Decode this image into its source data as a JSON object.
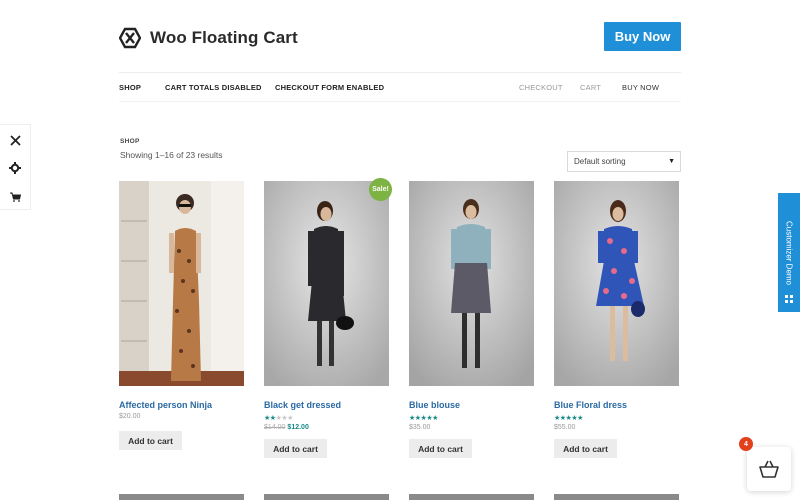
{
  "header": {
    "site_title": "Woo Floating Cart",
    "buy_now_label": "Buy Now"
  },
  "nav": {
    "left": [
      "SHOP",
      "CART TOTALS DISABLED",
      "CHECKOUT FORM ENABLED"
    ],
    "right": [
      "CHECKOUT",
      "CART",
      "BUY NOW"
    ]
  },
  "shop": {
    "breadcrumb": "SHOP",
    "result_count": "Showing 1–16 of 23 results",
    "sort_selected": "Default sorting"
  },
  "products": [
    {
      "title": "Affected person Ninja",
      "rating": null,
      "price": "$20.00",
      "old_price": null,
      "add_label": "Add to cart",
      "sale": false
    },
    {
      "title": "Black get dressed",
      "rating": 2,
      "price": "$12.00",
      "old_price": "$14.00",
      "add_label": "Add to cart",
      "sale": true,
      "sale_label": "Sale!"
    },
    {
      "title": "Blue blouse",
      "rating": 5,
      "price": "$35.00",
      "old_price": null,
      "add_label": "Add to cart",
      "sale": false
    },
    {
      "title": "Blue Floral dress",
      "rating": 5,
      "price": "$55.00",
      "old_price": null,
      "add_label": "Add to cart",
      "sale": false
    }
  ],
  "customizer": {
    "label": "Customizer Demo"
  },
  "floating_cart": {
    "count": "4"
  },
  "icons": {
    "side_tools": [
      "close-icon",
      "gear-icon",
      "cart-icon"
    ],
    "floating_cart": "shopping-basket-icon"
  },
  "colors": {
    "accent": "#1f8fd8",
    "link": "#2a6aa3",
    "rating": "#1a8a8a",
    "sale_badge": "#7cb342",
    "cart_badge": "#e2401c"
  }
}
